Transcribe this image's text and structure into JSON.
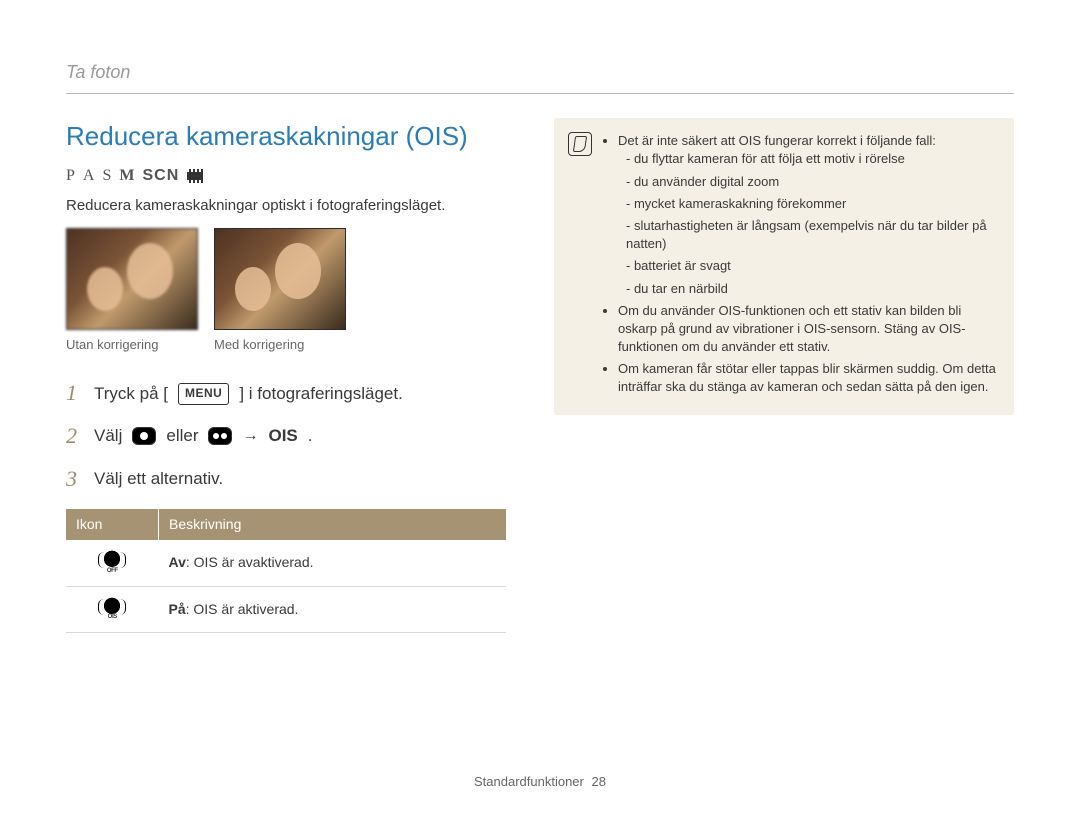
{
  "breadcrumb": "Ta foton",
  "heading": "Reducera kameraskakningar (OIS)",
  "modes": {
    "p": "P",
    "a": "A",
    "s": "S",
    "m": "M",
    "scn": "SCN"
  },
  "intro": "Reducera kameraskakningar optiskt i fotograferingsläget.",
  "images": {
    "left_caption": "Utan korrigering",
    "right_caption": "Med korrigering"
  },
  "steps": {
    "s1_a": "Tryck på [",
    "s1_menu": "MENU",
    "s1_b": "] i fotograferingsläget.",
    "s2_a": "Välj",
    "s2_or": "eller",
    "s2_arrow": "→",
    "s2_ois": "OIS",
    "s2_dot": ".",
    "s3": "Välj ett alternativ."
  },
  "table": {
    "h_icon": "Ikon",
    "h_desc": "Beskrivning",
    "rows": [
      {
        "sub": "OFF",
        "label_bold": "Av",
        "label_rest": ": OIS är avaktiverad."
      },
      {
        "sub": "OIS",
        "label_bold": "På",
        "label_rest": ": OIS är aktiverad."
      }
    ]
  },
  "note": {
    "b1": "Det är inte säkert att OIS fungerar korrekt i följande fall:",
    "b1_subs": [
      "du flyttar kameran för att följa ett motiv i rörelse",
      "du använder digital zoom",
      "mycket kameraskakning förekommer",
      "slutarhastigheten är långsam (exempelvis när du tar bilder på natten)",
      "batteriet är svagt",
      "du tar en närbild"
    ],
    "b2": "Om du använder OIS-funktionen och ett stativ kan bilden bli oskarp på grund av vibrationer i OIS-sensorn. Stäng av OIS-funktionen om du använder ett stativ.",
    "b3": "Om kameran får stötar eller tappas blir skärmen suddig. Om detta inträffar ska du stänga av kameran och sedan sätta på den igen."
  },
  "footer": {
    "section": "Standardfunktioner",
    "page": "28"
  }
}
